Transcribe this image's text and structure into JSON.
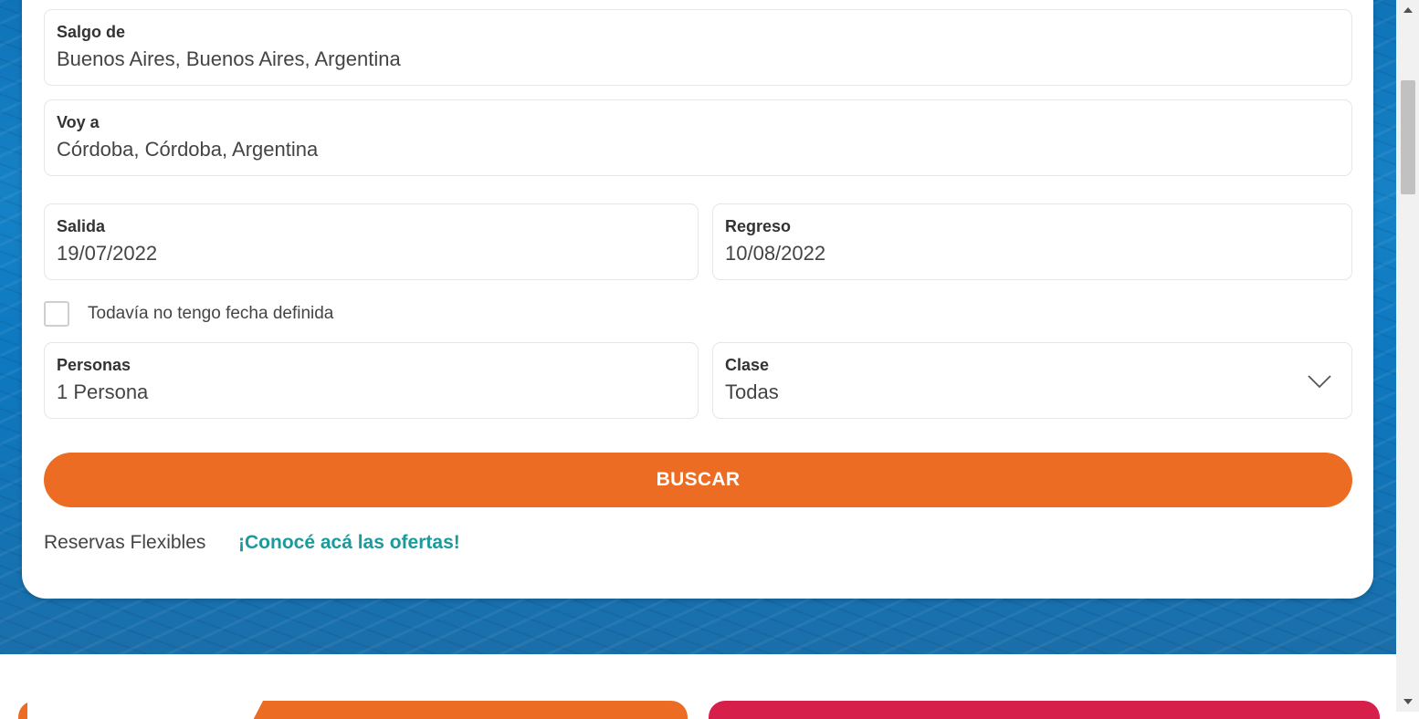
{
  "form": {
    "origin": {
      "label": "Salgo de",
      "value": "Buenos Aires, Buenos Aires, Argentina"
    },
    "destination": {
      "label": "Voy a",
      "value": "Córdoba, Córdoba, Argentina"
    },
    "departure": {
      "label": "Salida",
      "value": "19/07/2022"
    },
    "return": {
      "label": "Regreso",
      "value": "10/08/2022"
    },
    "no_date_checkbox": {
      "label": "Todavía no tengo fecha definida",
      "checked": false
    },
    "passengers": {
      "label": "Personas",
      "value": "1 Persona"
    },
    "cabin_class": {
      "label": "Clase",
      "value": "Todas",
      "icon": "chevron-down-icon"
    },
    "search_button": "BUSCAR",
    "flexible_text": "Reservas Flexibles",
    "offers_link": "¡Conocé acá las ofertas!"
  },
  "colors": {
    "accent": "#ec6c23",
    "link": "#1c9a9b",
    "promo_right": "#d61f4b",
    "sea": "#1682c6"
  }
}
